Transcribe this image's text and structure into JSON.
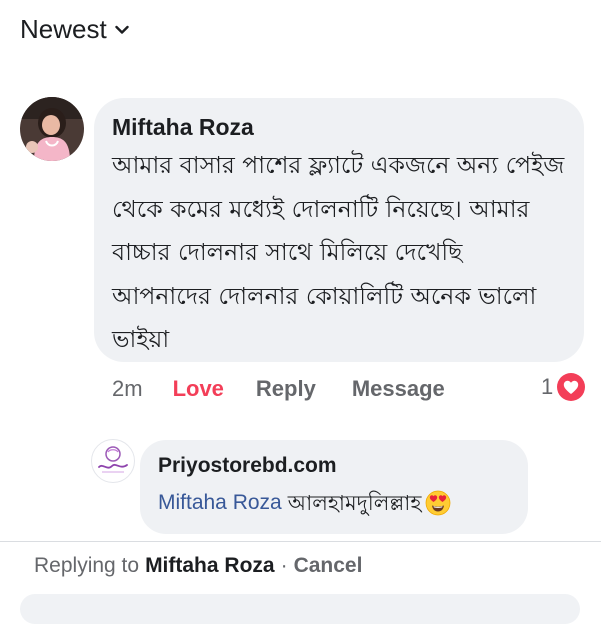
{
  "sort": {
    "label": "Newest",
    "icon": "chevron-down-icon"
  },
  "comment": {
    "author": "Miftaha Roza",
    "text": "আমার বাসার পাশের ফ্ল্যাটে একজনে অন্য পেইজ থেকে কমের মধ্যেই দোলনাটি নিয়েছে। আমার বাচ্চার দোলনার সাথে মিলিয়ে দেখেছি আপনাদের দোলনার কোয়ালিটি অনেক ভালো ভাইয়া",
    "time": "2m",
    "reaction_label": "Love",
    "reply_label": "Reply",
    "message_label": "Message",
    "reaction_count": "1",
    "reaction_icon": "heart-icon",
    "reaction_color": "#f33e58"
  },
  "reply": {
    "author": "Priyostorebd.com",
    "mention": "Miftaha Roza",
    "text": "আলহামদুলিল্লাহ",
    "emoji": "heart-eyes-emoji-icon"
  },
  "replying_bar": {
    "prefix": "Replying to",
    "target": "Miftaha Roza",
    "separator": "·",
    "cancel_label": "Cancel"
  },
  "colors": {
    "bubble_bg": "#eff1f4",
    "love_red": "#f33e58",
    "mention_blue": "#385898",
    "secondary_text": "#65676b"
  }
}
